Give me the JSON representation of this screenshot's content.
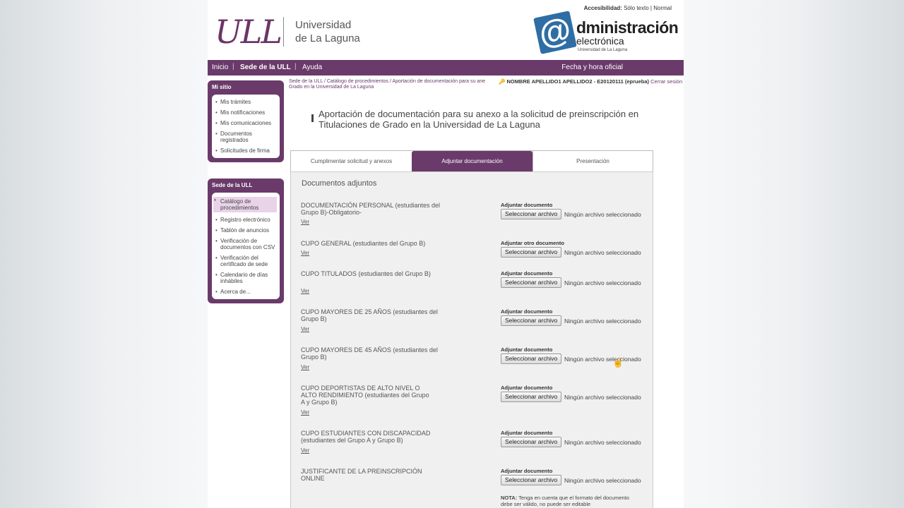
{
  "header": {
    "logo_text": "ULL",
    "uni_line1": "Universidad",
    "uni_line2": "de La Laguna",
    "access_label": "Accesibilidad:",
    "access_text_only": "Sólo texto",
    "access_sep": "|",
    "access_normal": "Normal",
    "admin_at": "@",
    "admin_word": "dministración",
    "admin_sub": "electrónica",
    "admin_uni": "Universidad de La Laguna"
  },
  "nav": {
    "items": [
      "Inicio",
      "Sede de la ULL",
      "Ayuda"
    ],
    "sep": "|",
    "right": "Fecha y hora oficial"
  },
  "sidebar": {
    "mi_sitio": {
      "title": "Mi sitio",
      "items": [
        "Mis trámites",
        "Mis notificaciones",
        "Mis comunicaciones",
        "Documentos registrados",
        "Solicitudes de firma"
      ]
    },
    "sede": {
      "title": "Sede de la ULL",
      "items": [
        "Catálogo de procedimientos",
        "Registro electrónico",
        "Tablón de anuncios",
        "Verificación de documentos con CSV",
        "Verificación del certificado de sede",
        "Calendario de días inhábiles",
        "Acerca de..."
      ]
    }
  },
  "breadcrumb": {
    "line1": "Sede de la ULL / Catálogo de procedimientos / Aportación de documentación para su ane",
    "line2": "Grado en la Universidad de La Laguna"
  },
  "user": {
    "key_icon": "🔑",
    "name": "NOMBRE APELLIDO1 APELLIDO2 - E20120111 (eprueba)",
    "close": "Cerrar sesión"
  },
  "page_title": "Aportación de documentación para su anexo a la solicitud de preinscripción en Titulaciones de Grado en la Universidad de La Laguna",
  "tabs": [
    "Cumplimentar solicitud y anexos",
    "Adjuntar documentación",
    "Presentación"
  ],
  "panel_heading": "Documentos adjuntos",
  "file_button": "Seleccionar archivo",
  "file_status": "Ningún archivo seleccionado",
  "documents": [
    {
      "label": "DOCUMENTACIÓN PERSONAL (estudiantes del Grupo B)-Obligatorio-",
      "link": "Ver",
      "upload": "Adjuntar documento"
    },
    {
      "label": "CUPO GENERAL (estudiantes del Grupo B)",
      "link": "Ver",
      "upload": "Adjuntar otro documento"
    },
    {
      "label": "CUPO TITULADOS (estudiantes del Grupo B)",
      "link": "Ver",
      "upload": "Adjuntar documento"
    },
    {
      "label": "CUPO MAYORES DE 25 AÑOS (estudiantes del Grupo B)",
      "link": "Ver",
      "upload": "Adjuntar documento"
    },
    {
      "label": "CUPO MAYORES DE 45 AÑOS (estudiantes del Grupo B)",
      "link": "Ver",
      "upload": "Adjuntar documento"
    },
    {
      "label": "CUPO DEPORTISTAS DE ALTO NIVEL O ALTO RENDIMIENTO (estudiantes del Grupo A y Grupo B)",
      "link": "Ver",
      "upload": "Adjuntar documento"
    },
    {
      "label": "CUPO ESTUDIANTES CON DISCAPACIDAD (estudiantes del Grupo A y Grupo B)",
      "link": "Ver",
      "upload": "Adjuntar documento"
    },
    {
      "label": "JUSTIFICANTE DE LA PREINSCRIPCIÓN ONLINE",
      "link": "",
      "upload": "Adjuntar documento"
    }
  ],
  "note": {
    "label": "NOTA:",
    "text": "Tenga en cuenta que el formato del documento debe ser válido, no puede ser editable"
  }
}
